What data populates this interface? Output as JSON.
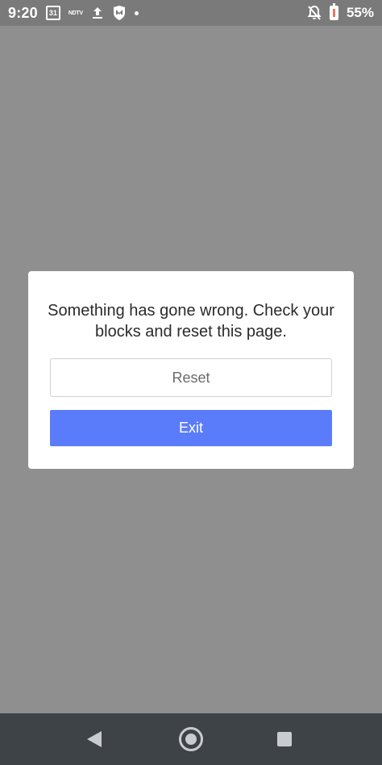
{
  "status_bar": {
    "time": "9:20",
    "calendar_date": "31",
    "ndtv": "NDTV",
    "battery": "55%"
  },
  "dialog": {
    "message": "Something has gone wrong. Check your blocks and reset this page.",
    "reset_label": "Reset",
    "exit_label": "Exit"
  },
  "colors": {
    "overlay": "#8f8f8f",
    "exit_button": "#5b7cfa",
    "nav_bar": "#3e4348"
  }
}
